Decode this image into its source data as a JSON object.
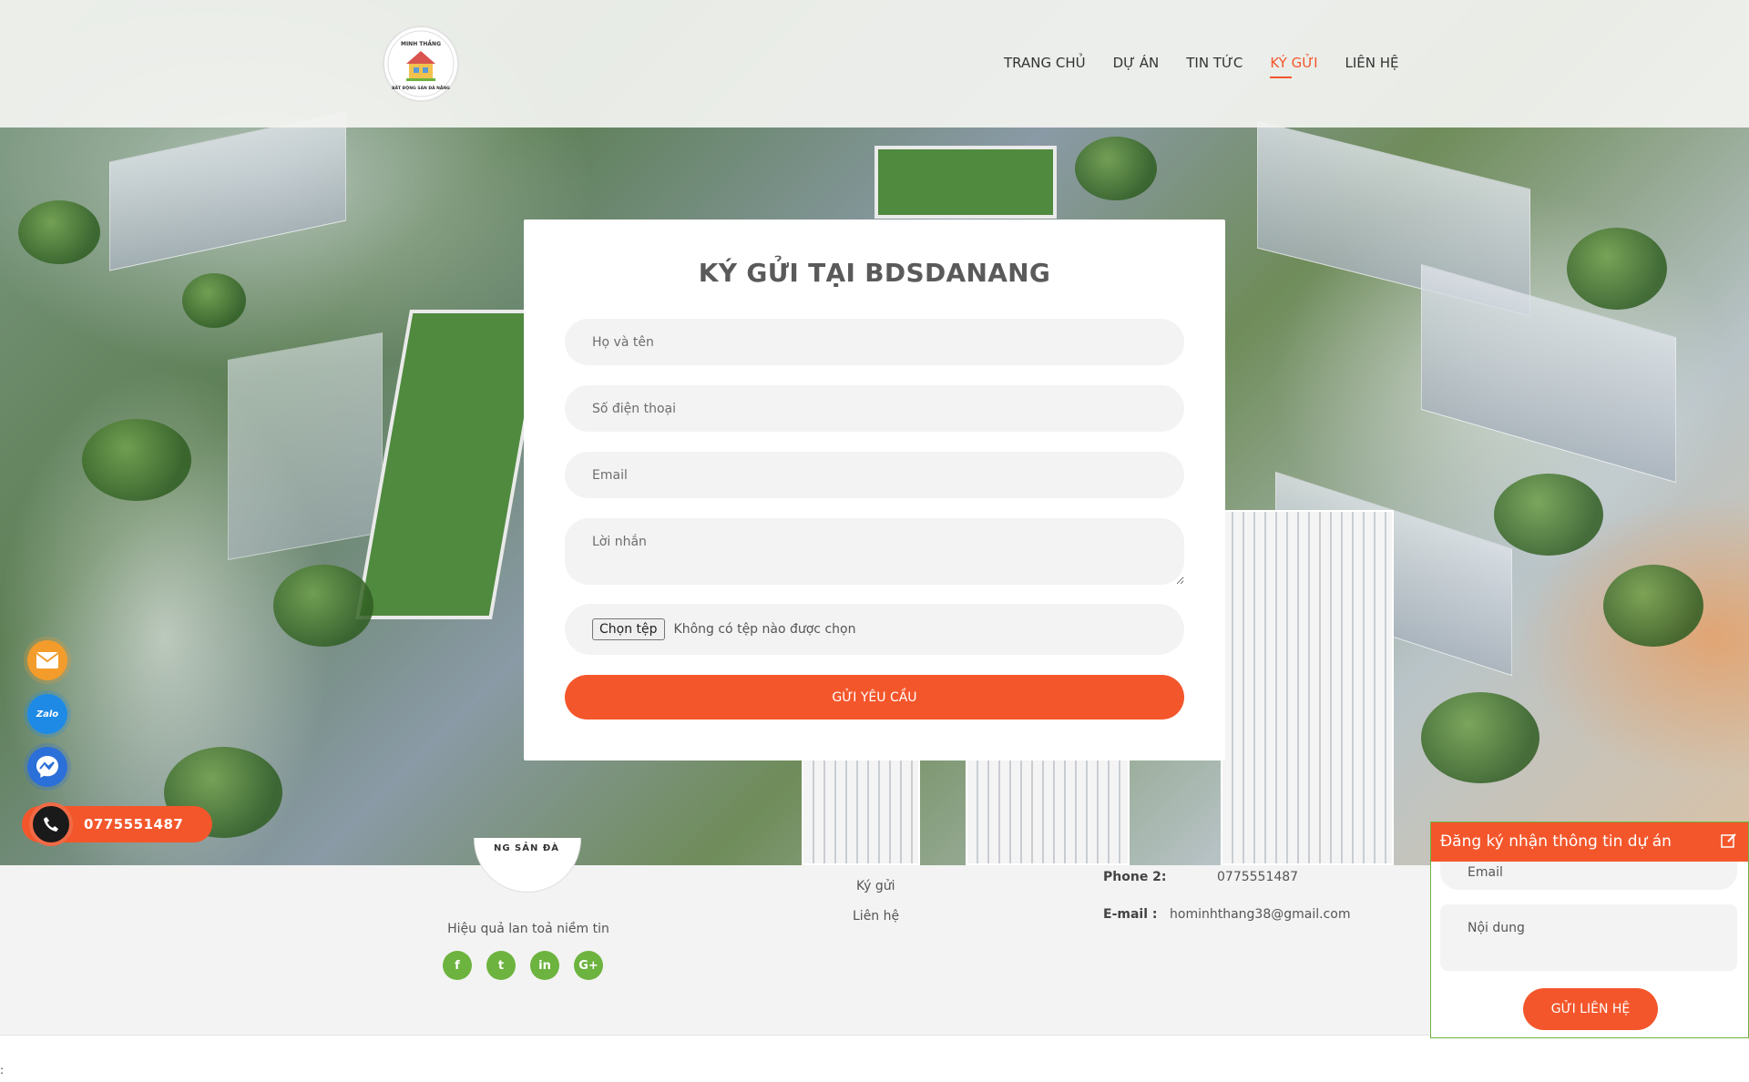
{
  "header": {
    "logo": {
      "text_top": "MINH THẮNG",
      "text_bottom": "BẤT ĐỘNG SẢN ĐÀ NẴNG"
    },
    "nav": [
      {
        "label": "TRANG CHỦ",
        "active": false
      },
      {
        "label": "DỰ ÁN",
        "active": false
      },
      {
        "label": "TIN TỨC",
        "active": false
      },
      {
        "label": "KÝ GỬI",
        "active": true
      },
      {
        "label": "LIÊN HỆ",
        "active": false
      }
    ]
  },
  "form": {
    "title": "KÝ GỬI TẠI BDSDANANG",
    "name_placeholder": "Họ và tên",
    "phone_placeholder": "Số điện thoại",
    "email_placeholder": "Email",
    "message_placeholder": "Lời nhắn",
    "file_button": "Chọn tệp",
    "file_status": "Không có tệp nào được chọn",
    "submit_label": "GỬI YÊU CẦU"
  },
  "footer": {
    "logo_text": "NG SẢN ĐÀ",
    "tagline": "Hiệu quả lan toả niềm tin",
    "socials": [
      {
        "name": "facebook",
        "glyph": "f"
      },
      {
        "name": "twitter",
        "glyph": "t"
      },
      {
        "name": "linkedin",
        "glyph": "in"
      },
      {
        "name": "google-plus",
        "glyph": "G+"
      }
    ],
    "links": [
      "Ký gửi",
      "Liên hệ"
    ],
    "phone2_label": "Phone 2:",
    "phone2_value": "0775551487",
    "email_label": "E-mail :",
    "email_value": "hominhthang38@gmail.com",
    "stray_text": ":"
  },
  "floating": {
    "phone_number": "0775551487",
    "zalo_label": "Zalo"
  },
  "widget": {
    "title": "Đăng ký nhận thông tin dự án",
    "email_placeholder": "Email",
    "content_placeholder": "Nội dung",
    "submit_label": "GỬI LIÊN HỆ"
  },
  "colors": {
    "accent": "#f4562b",
    "social_green": "#6db33f",
    "zalo_blue": "#1f8ae6",
    "messenger_blue": "#2b6fd8",
    "email_orange": "#f39c2b"
  }
}
